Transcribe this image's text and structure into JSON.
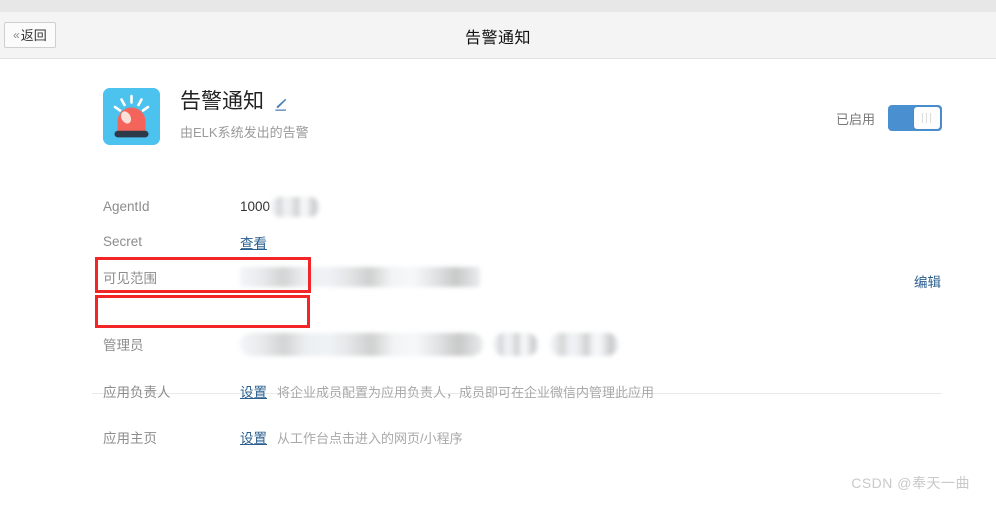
{
  "window": {
    "title": "告警通知"
  },
  "header": {
    "back_button": "返回",
    "back_chevrons": "«",
    "title": "告警通知"
  },
  "app": {
    "icon_name": "alarm-siren-icon",
    "name": "告警通知",
    "description": "由ELK系统发出的告警",
    "icon_colors": {
      "background": "#4cc2ee",
      "dome": "#f4645a",
      "base": "#2d3a4a",
      "rays": "#ffffff"
    }
  },
  "status": {
    "label": "已启用",
    "enabled": true,
    "toggle_color": "#4a8fd0"
  },
  "actions": {
    "edit_link": "编辑"
  },
  "fields": [
    {
      "label": "AgentId",
      "value": "1000",
      "redacted": true,
      "highlighted": true
    },
    {
      "label": "Secret",
      "link": "查看",
      "highlighted": true
    },
    {
      "label": "可见范围",
      "redacted": true
    }
  ],
  "fields2": [
    {
      "label": "管理员",
      "redacted": true
    },
    {
      "label": "应用负责人",
      "link": "设置",
      "hint": "将企业成员配置为应用负责人，成员即可在企业微信内管理此应用"
    },
    {
      "label": "应用主页",
      "link": "设置",
      "hint": "从工作台点击进入的网页/小程序"
    }
  ],
  "annotations": {
    "box_color": "#f22626",
    "boxes": [
      "AgentId",
      "Secret"
    ]
  },
  "watermark": "CSDN @奉天一曲"
}
